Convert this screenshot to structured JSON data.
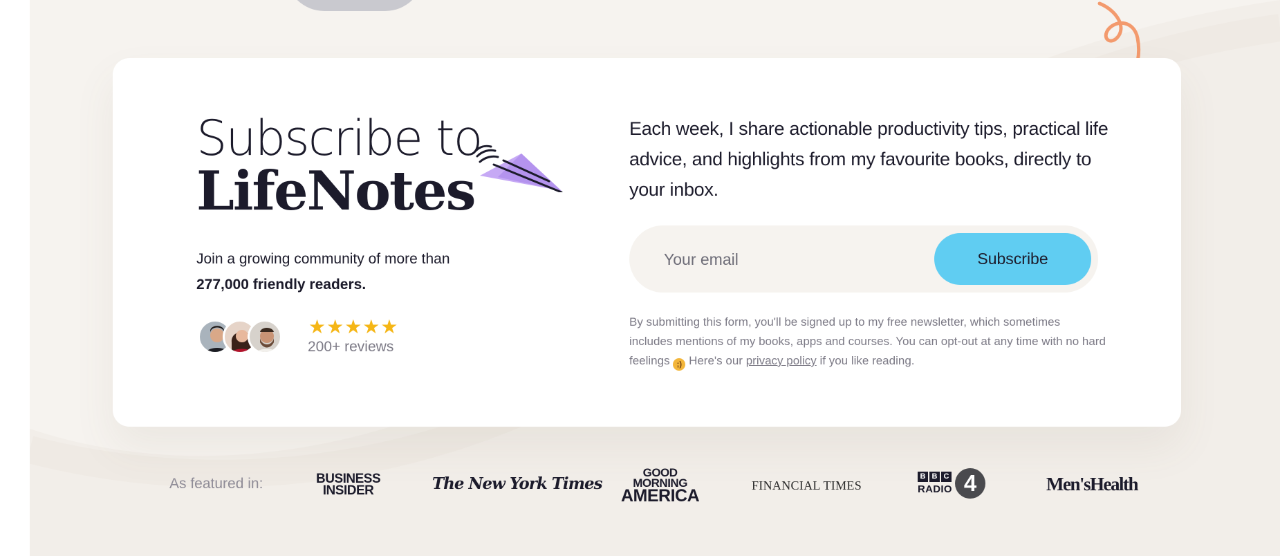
{
  "hero": {
    "title_line1": "Subscribe to",
    "title_line2": "LifeNotes",
    "community_text": "Join a growing community of more than",
    "community_count": "277,000 friendly readers.",
    "rating_stars": "★★★★★",
    "rating_value": 5,
    "reviews_text": "200+ reviews"
  },
  "signup": {
    "description": "Each week, I share actionable productivity tips, practical life advice, and highlights from my favourite books, directly to your inbox.",
    "email_placeholder": "Your email",
    "email_value": "",
    "subscribe_label": "Subscribe",
    "legal_part1": "By submitting this form, you'll be signed up to my free newsletter, which sometimes includes mentions of my books, apps and courses. You can opt-out at any time with no hard feelings",
    "legal_emoji": "wink-face-icon",
    "legal_part2": "Here's our",
    "privacy_link": "privacy policy",
    "legal_part3": "if you like reading."
  },
  "featured": {
    "label": "As featured in:",
    "logos": {
      "business_insider_line1": "BUSINESS",
      "business_insider_line2": "INSIDER",
      "nyt": "The New York Times",
      "gma_line1": "GOOD",
      "gma_line2": "MORNING",
      "gma_line3": "AMERICA",
      "ft": "FINANCIAL TIMES",
      "bbc_b1": "B",
      "bbc_b2": "B",
      "bbc_c": "C",
      "bbc_radio": "RADIO",
      "bbc_number": "4",
      "mens_health": "Men'sHealth"
    }
  },
  "colors": {
    "background": "#f6f3ef",
    "card": "#ffffff",
    "text": "#1c1b2b",
    "muted": "#7c7a86",
    "button": "#60cdf2",
    "stars": "#f5b616",
    "arrow": "#f39a6d",
    "plane": "#c6a9f5"
  },
  "icons": {
    "plane": "paper-plane-icon",
    "arrow": "curly-arrow-icon",
    "stars": "star-icon"
  }
}
